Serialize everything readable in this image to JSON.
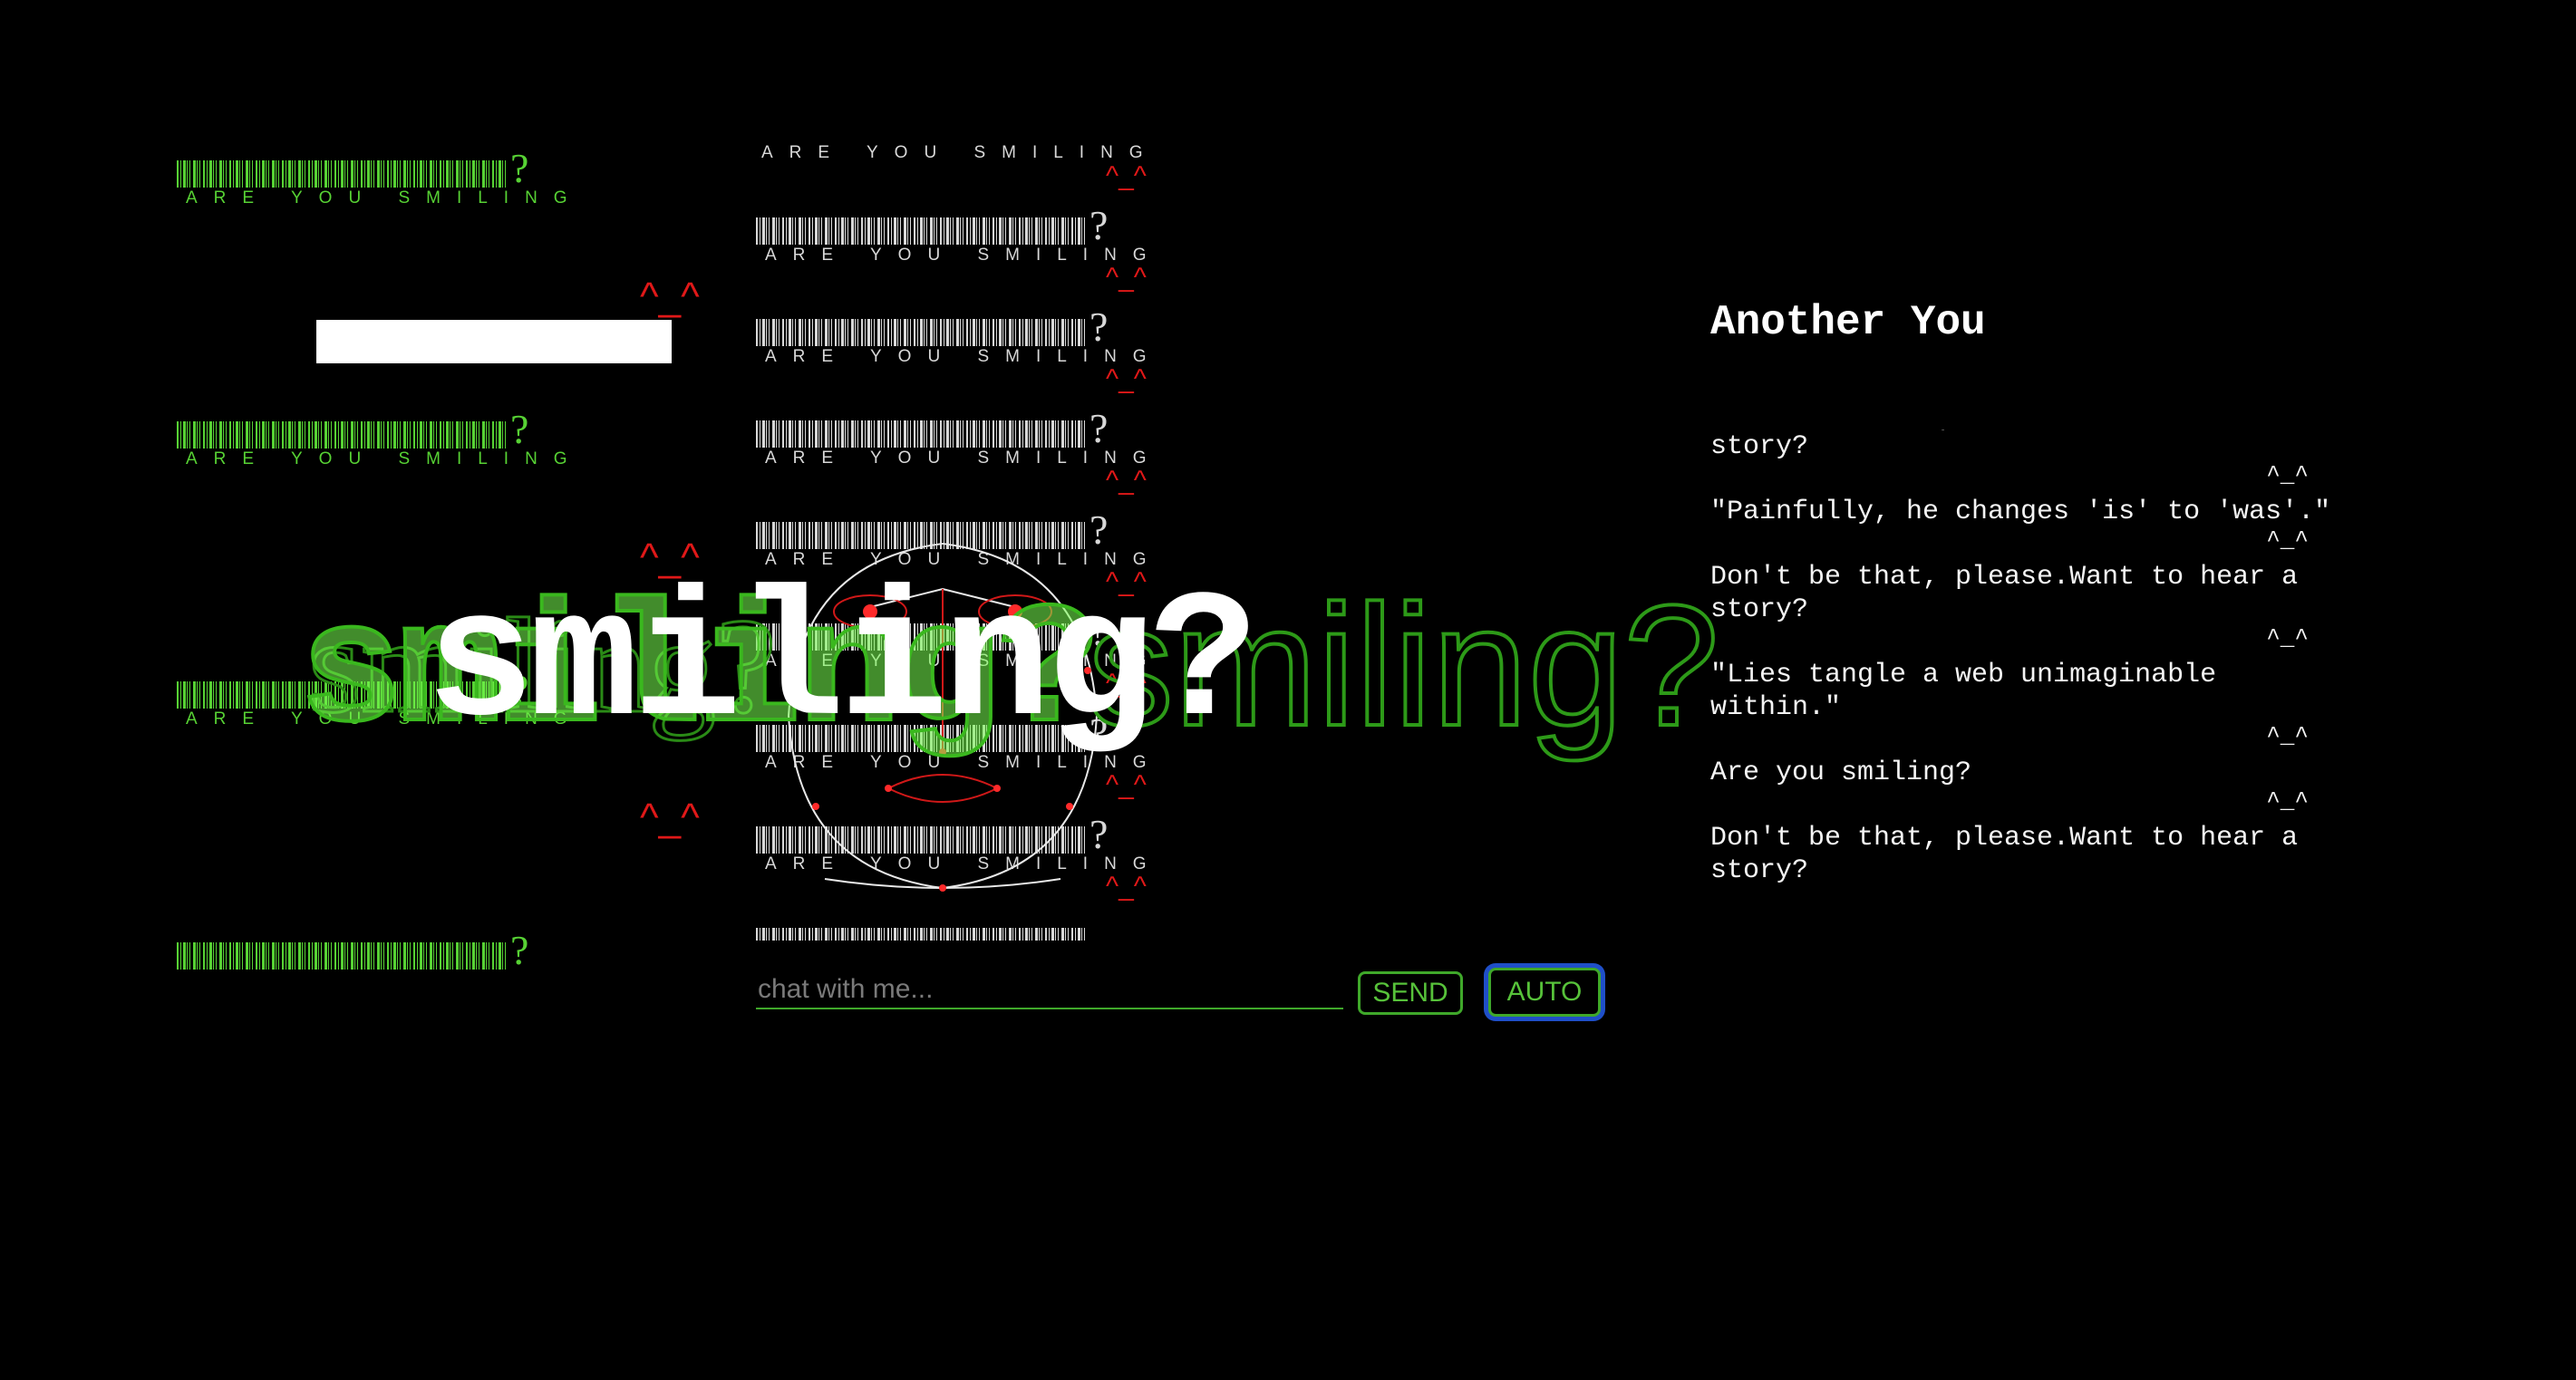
{
  "barcode_caption": "ARE YOU SMILING",
  "question_mark": "?",
  "kaomoji_small": "^_^",
  "kaomoji_big": "^_^",
  "overlay_word": "smiling?",
  "chat": {
    "placeholder": "chat with me...",
    "send_label": "SEND",
    "auto_label": "AUTO"
  },
  "panel": {
    "title": "Another You",
    "cut_line": "· -",
    "messages": [
      {
        "text": "story?",
        "reply": "^_^"
      },
      {
        "text": "\"Painfully, he changes 'is' to 'was'.\"",
        "reply": "^_^"
      },
      {
        "text": "Don't be that, please.Want to hear a story?",
        "reply": "^_^"
      },
      {
        "text": "\"Lies tangle a web unimaginable within.\"",
        "reply": "^_^"
      },
      {
        "text": "Are you smiling?",
        "reply": "^_^"
      },
      {
        "text": "Don't be that, please.Want to hear a story?",
        "reply": ""
      }
    ]
  },
  "colors": {
    "green": "#57d234",
    "red": "#e01818",
    "focus_ring": "#1f4fc8"
  }
}
